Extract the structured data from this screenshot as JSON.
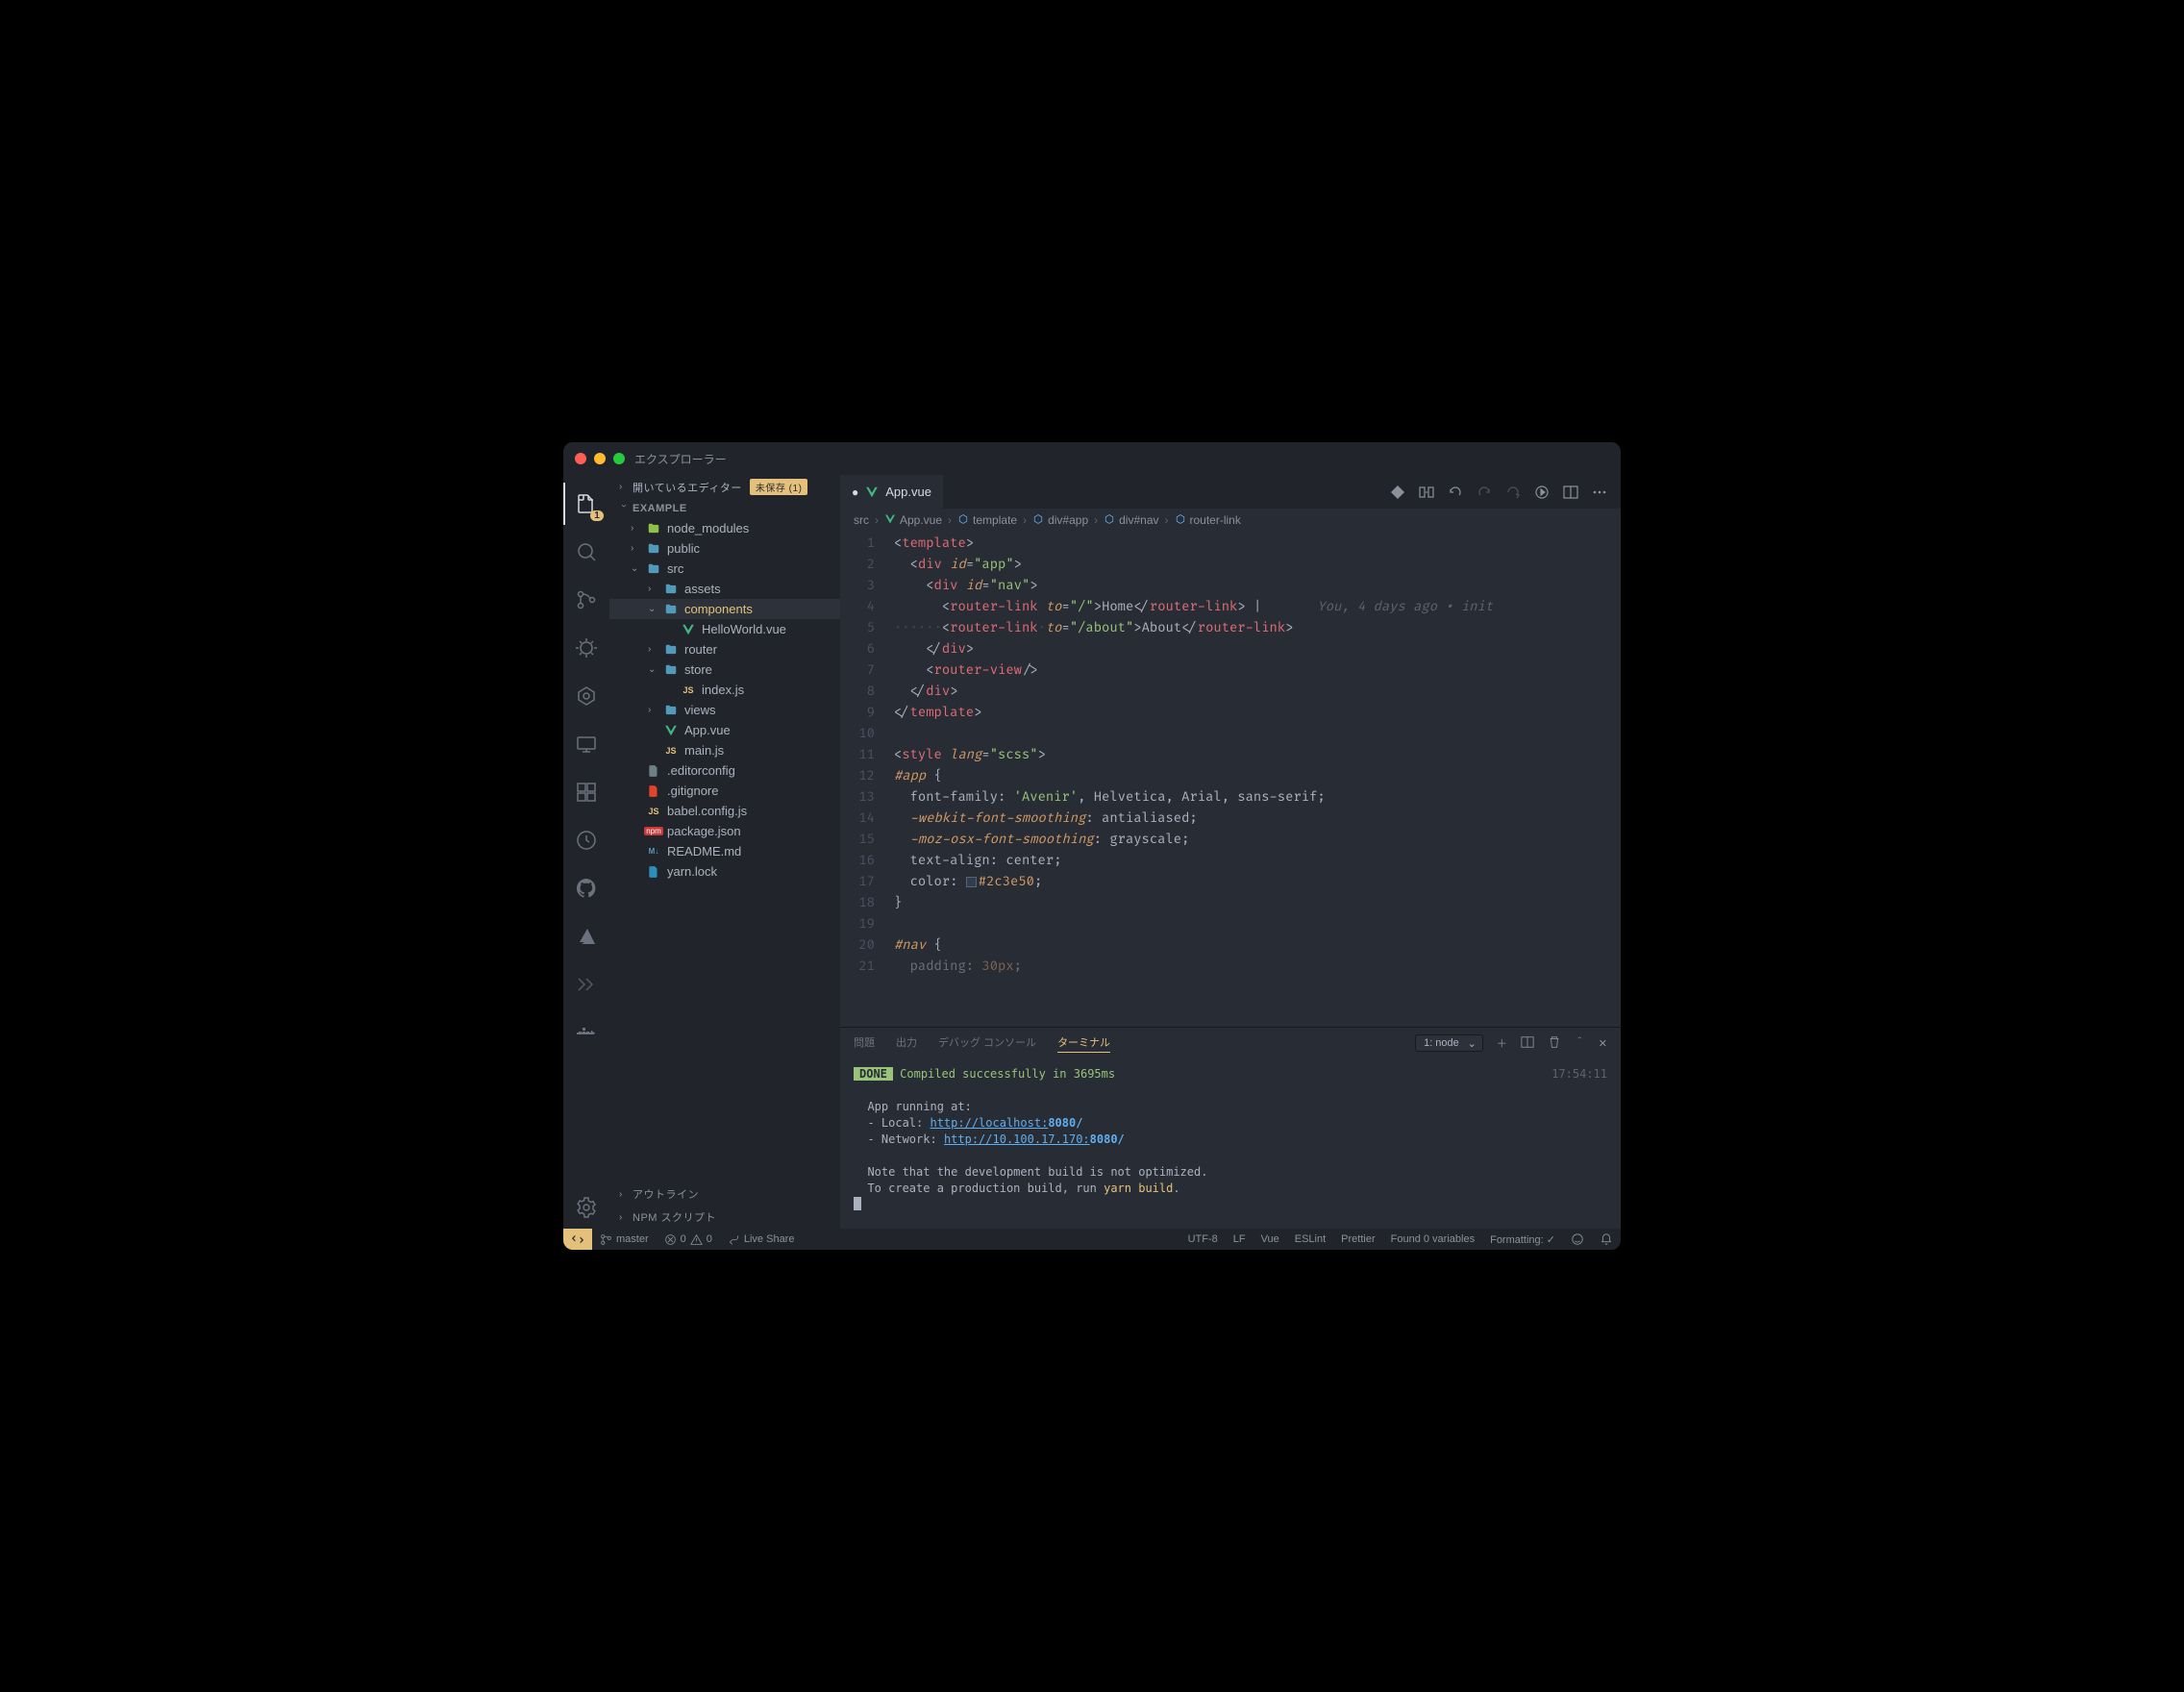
{
  "titlebar": {
    "title": "エクスプローラー"
  },
  "activitybar": {
    "badge": "1"
  },
  "sidebar": {
    "openEditorsHeader": "開いているエディター",
    "unsavedLabel": "未保存 (1)",
    "workspaceName": "EXAMPLE",
    "outline": "アウトライン",
    "npmScripts": "NPM スクリプト",
    "tree": [
      {
        "label": "node_modules",
        "type": "folder",
        "indent": 1,
        "expanded": false,
        "iconColor": "#8dc149"
      },
      {
        "label": "public",
        "type": "folder",
        "indent": 1,
        "expanded": false
      },
      {
        "label": "src",
        "type": "folder",
        "indent": 1,
        "expanded": true
      },
      {
        "label": "assets",
        "type": "folder",
        "indent": 2,
        "expanded": false
      },
      {
        "label": "components",
        "type": "folder",
        "indent": 2,
        "expanded": true,
        "selected": true
      },
      {
        "label": "HelloWorld.vue",
        "type": "vue",
        "indent": 3
      },
      {
        "label": "router",
        "type": "folder",
        "indent": 2,
        "expanded": false
      },
      {
        "label": "store",
        "type": "folder",
        "indent": 2,
        "expanded": true
      },
      {
        "label": "index.js",
        "type": "js",
        "indent": 3
      },
      {
        "label": "views",
        "type": "folder",
        "indent": 2,
        "expanded": false
      },
      {
        "label": "App.vue",
        "type": "vue",
        "indent": 2
      },
      {
        "label": "main.js",
        "type": "js",
        "indent": 2
      },
      {
        "label": ".editorconfig",
        "type": "config",
        "indent": 1,
        "iconColor": "#6d8086"
      },
      {
        "label": ".gitignore",
        "type": "git",
        "indent": 1,
        "iconColor": "#e24329"
      },
      {
        "label": "babel.config.js",
        "type": "js",
        "indent": 1
      },
      {
        "label": "package.json",
        "type": "npm",
        "indent": 1
      },
      {
        "label": "README.md",
        "type": "md",
        "indent": 1
      },
      {
        "label": "yarn.lock",
        "type": "yarn",
        "indent": 1,
        "iconColor": "#2c8ebb"
      }
    ]
  },
  "tabs": {
    "active": {
      "label": "App.vue",
      "dirty": true
    }
  },
  "breadcrumbs": [
    {
      "label": "src",
      "icon": ""
    },
    {
      "label": "App.vue",
      "icon": "vue"
    },
    {
      "label": "template",
      "icon": "block"
    },
    {
      "label": "div#app",
      "icon": "block"
    },
    {
      "label": "div#nav",
      "icon": "block"
    },
    {
      "label": "router-link",
      "icon": "block"
    }
  ],
  "editor": {
    "blame": "You, 4 days ago • init",
    "lines": 21
  },
  "panel": {
    "tabs": {
      "problems": "問題",
      "output": "出力",
      "debug": "デバッグ コンソール",
      "terminal": "ターミナル"
    },
    "terminalSelect": "1: node",
    "doneLabel": "DONE",
    "compiled": "Compiled successfully in 3695ms",
    "time": "17:54:11",
    "running": "App running at:",
    "localLabel": "- Local:   ",
    "localUrl": "http://localhost:",
    "localPort": "8080/",
    "networkLabel": "- Network: ",
    "networkUrl": "http://10.100.17.170:",
    "networkPort": "8080/",
    "note1": "Note that the development build is not optimized.",
    "note2a": "To create a production build, run ",
    "note2b": "yarn build",
    "note2c": "."
  },
  "statusbar": {
    "branch": "master",
    "errors": "0",
    "warnings": "0",
    "liveShare": "Live Share",
    "encoding": "UTF-8",
    "eol": "LF",
    "lang": "Vue",
    "eslint": "ESLint",
    "prettier": "Prettier",
    "variables": "Found 0 variables",
    "formatting": "Formatting: ✓"
  }
}
